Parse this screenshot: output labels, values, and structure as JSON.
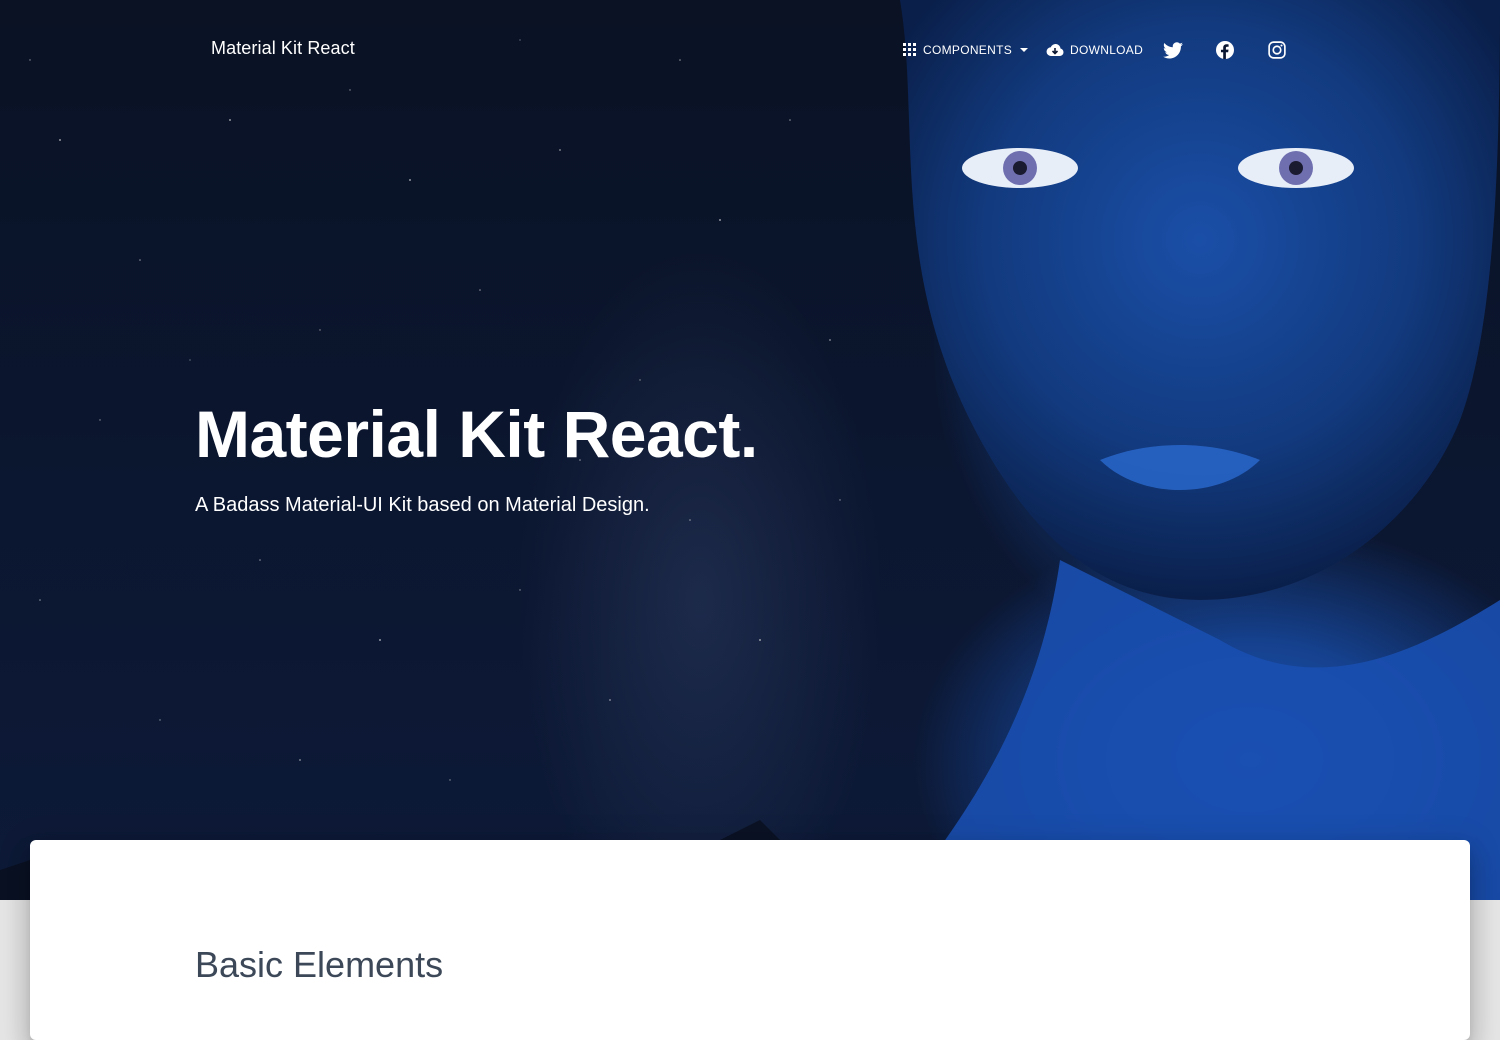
{
  "brand": "Material Kit React",
  "nav": {
    "components_label": "Components",
    "download_label": "Download",
    "social_icons": [
      "twitter-icon",
      "facebook-icon",
      "instagram-icon"
    ]
  },
  "hero": {
    "title": "Material Kit React.",
    "subtitle": "A Badass Material-UI Kit based on Material Design."
  },
  "main": {
    "section_title": "Basic Elements"
  },
  "colors": {
    "hero_dark": "#0b1630",
    "paint_blue": "#1f5ac0",
    "text_white": "#ffffff",
    "card_bg": "#ffffff",
    "section_title": "#3c4858",
    "page_bg": "#e5e5e5"
  }
}
